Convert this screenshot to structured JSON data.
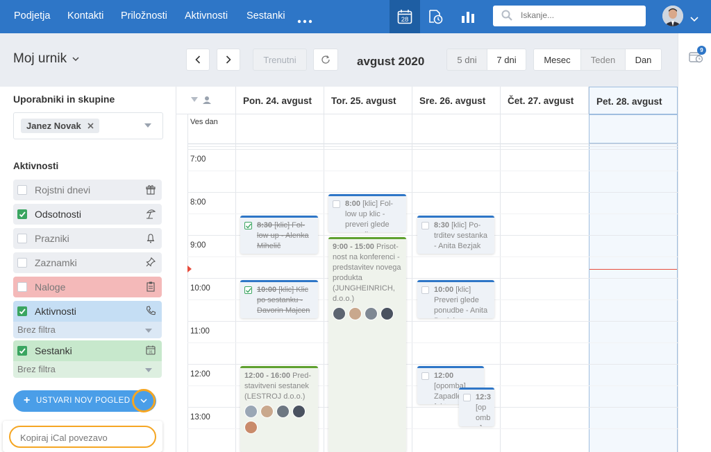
{
  "nav": {
    "items": [
      {
        "label": "Podjetja"
      },
      {
        "label": "Kontakti"
      },
      {
        "label": "Priložnosti"
      },
      {
        "label": "Aktivnosti"
      },
      {
        "label": "Sestanki"
      }
    ],
    "calendar_icon_day": "28",
    "search_placeholder": "Iskanje...",
    "notification_count": "9"
  },
  "toolbar": {
    "view_title": "Moj urnik",
    "today_label": "Trenutni",
    "period_label": "avgust 2020",
    "days_options": [
      {
        "label": "5 dni"
      },
      {
        "label": "7 dni"
      }
    ],
    "view_options": [
      {
        "label": "Mesec"
      },
      {
        "label": "Teden"
      },
      {
        "label": "Dan"
      }
    ]
  },
  "sidebar": {
    "users_title": "Uporabniki in skupine",
    "selected_user": "Janez Novak",
    "activities_title": "Aktivnosti",
    "items": [
      {
        "label": "Rojstni dnevi",
        "checked": false,
        "icon": "gift-icon"
      },
      {
        "label": "Odsotnosti",
        "checked": true,
        "icon": "beach-umbrella-icon"
      },
      {
        "label": "Prazniki",
        "checked": false,
        "icon": "bell-icon"
      },
      {
        "label": "Zaznamki",
        "checked": false,
        "icon": "pin-icon"
      },
      {
        "label": "Naloge",
        "checked": false,
        "icon": "clipboard-icon"
      },
      {
        "label": "Aktivnosti",
        "checked": true,
        "icon": "phone-icon",
        "filter": "Brez filtra"
      },
      {
        "label": "Sestanki",
        "checked": true,
        "icon": "calendar-icon",
        "filter": "Brez filtra"
      }
    ],
    "create_view_label": "USTVARI NOV POGLED",
    "ical_label": "Kopiraj iCal povezavo"
  },
  "calendar": {
    "days": [
      {
        "label": "Pon. 24. avgust"
      },
      {
        "label": "Tor. 25. avgust"
      },
      {
        "label": "Sre. 26. avgust"
      },
      {
        "label": "Čet. 27. avgust"
      },
      {
        "label": "Pet. 28. avgust"
      }
    ],
    "all_day_label": "Ves dan",
    "hours": [
      {
        "label": "7:00"
      },
      {
        "label": "8:00"
      },
      {
        "label": "9:00"
      },
      {
        "label": "10:00"
      },
      {
        "label": "11:00"
      },
      {
        "label": "12:00"
      },
      {
        "label": "13:00"
      }
    ],
    "events": [
      {
        "time": "8:30",
        "text": "[klic] Fol- low up - Alenka Mihelič",
        "done": true
      },
      {
        "time": "10:00",
        "text": "[klic] Klic po sestanku - Davorin Majcen",
        "done": true
      },
      {
        "time": "12:00 - 16:00",
        "text": "Pred- stavitveni sestanek (LESTROJ d.o.o.)"
      },
      {
        "time": "8:00",
        "text": "[klic] Fol- low up klic - preveri glede ponudbe"
      },
      {
        "time": "9:00 - 15:00",
        "text": "Prisot- nost na konferenci - predstavitev novega produkta (JUNGHEINRICH, d.o.o.)"
      },
      {
        "time": "8:30",
        "text": "[klic] Po- trditev sestanka - Anita Bezjak"
      },
      {
        "time": "10:00",
        "text": "[klic] Preveri glede ponudbe - Anita Bezjak"
      },
      {
        "time": "12:00",
        "text": "[opomba] Zapadle fakture"
      },
      {
        "time": "12:3",
        "text": "[op omb a]"
      }
    ]
  },
  "colors": {
    "brand": "#2e76c7",
    "green": "#3aa560",
    "accent": "#f5a623"
  }
}
